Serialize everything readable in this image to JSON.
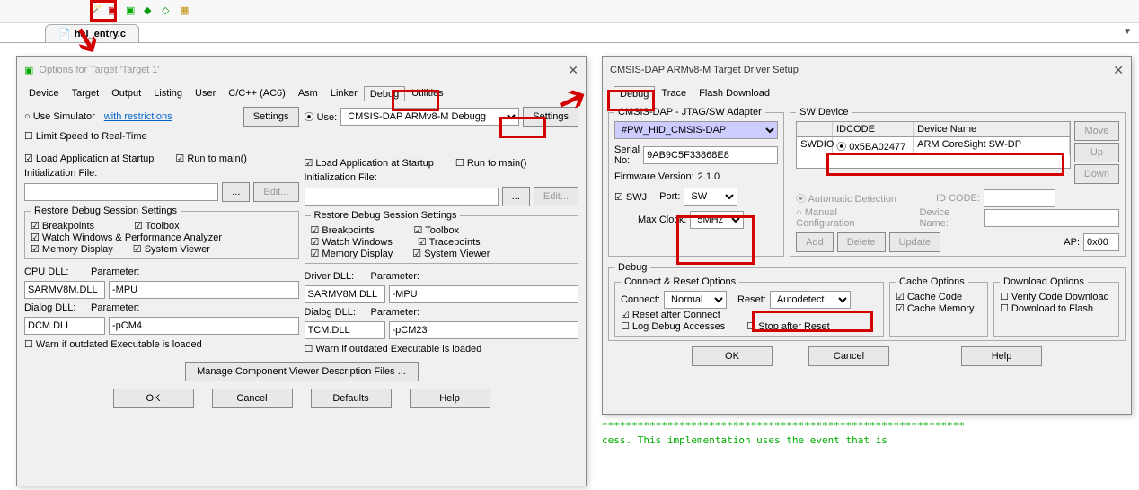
{
  "file_tab": "hal_entry.c",
  "dlg1": {
    "title": "Options for Target 'Target 1'",
    "tabs": [
      "Device",
      "Target",
      "Output",
      "Listing",
      "User",
      "C/C++ (AC6)",
      "Asm",
      "Linker",
      "Debug",
      "Utilities"
    ],
    "active_tab": "Debug",
    "use_sim": "Use Simulator",
    "restrictions": "with restrictions",
    "settings": "Settings",
    "limit_speed": "Limit Speed to Real-Time",
    "use": "Use:",
    "debugger": "CMSIS-DAP ARMv8-M Debugg",
    "load_app": "Load Application at Startup",
    "run_main": "Run to main()",
    "init_file": "Initialization File:",
    "edit": "Edit...",
    "browse": "...",
    "restore": "Restore Debug Session Settings",
    "breakpoints": "Breakpoints",
    "toolbox": "Toolbox",
    "watch_perf": "Watch Windows & Performance Analyzer",
    "watch_win": "Watch Windows",
    "tracepoints": "Tracepoints",
    "memory": "Memory Display",
    "sysview": "System Viewer",
    "cpu_dll": "CPU DLL:",
    "driver_dll": "Driver DLL:",
    "param": "Parameter:",
    "dialog_dll": "Dialog DLL:",
    "cpu_dll_v": "SARMV8M.DLL",
    "cpu_param_v": "-MPU",
    "drv_dll_v": "SARMV8M.DLL",
    "drv_param_v": "-MPU",
    "dlg_dll_l_v": "DCM.DLL",
    "dlg_param_l_v": "-pCM4",
    "dlg_dll_r_v": "TCM.DLL",
    "dlg_param_r_v": "-pCM23",
    "warn_out": "Warn if outdated Executable is loaded",
    "manage": "Manage Component Viewer Description Files ...",
    "ok": "OK",
    "cancel": "Cancel",
    "defaults": "Defaults",
    "help": "Help"
  },
  "dlg2": {
    "title": "CMSIS-DAP ARMv8-M Target Driver Setup",
    "tabs": [
      "Debug",
      "Trace",
      "Flash Download"
    ],
    "active_tab": "Debug",
    "grp_adapter": "CMSIS-DAP - JTAG/SW Adapter",
    "adapter_sel": "#PW_HID_CMSIS-DAP",
    "serial_no": "Serial No:",
    "serial_v": "9AB9C5F33868E8",
    "fw_ver": "Firmware Version:",
    "fw_v": "2.1.0",
    "swj": "SWJ",
    "port": "Port:",
    "port_v": "SW",
    "max_clock": "Max Clock:",
    "clock_v": "5MHz",
    "grp_sw": "SW Device",
    "col_idcode": "IDCODE",
    "col_devname": "Device Name",
    "swdio": "SWDIO",
    "idcode_v": "0x5BA02477",
    "devname_v": "ARM CoreSight SW-DP",
    "move": "Move",
    "up": "Up",
    "down": "Down",
    "auto_det": "Automatic Detection",
    "manual_cfg": "Manual Configuration",
    "id_code": "ID CODE:",
    "dev_name_l": "Device Name:",
    "add": "Add",
    "delete": "Delete",
    "update": "Update",
    "ap": "AP:",
    "ap_v": "0x00",
    "grp_debug": "Debug",
    "grp_conn": "Connect & Reset Options",
    "connect": "Connect:",
    "connect_v": "Normal",
    "reset": "Reset:",
    "reset_v": "Autodetect",
    "reset_after": "Reset after Connect",
    "log_dbg": "Log Debug Accesses",
    "stop_after": "Stop after Reset",
    "grp_cache": "Cache Options",
    "cache_code": "Cache Code",
    "cache_mem": "Cache Memory",
    "grp_dl": "Download Options",
    "verify": "Verify Code Download",
    "dl_flash": "Download to Flash",
    "ok": "OK",
    "cancel": "Cancel",
    "help": "Help"
  },
  "code1": "*************************************************************",
  "code2": "cess.  This implementation uses the event that is"
}
